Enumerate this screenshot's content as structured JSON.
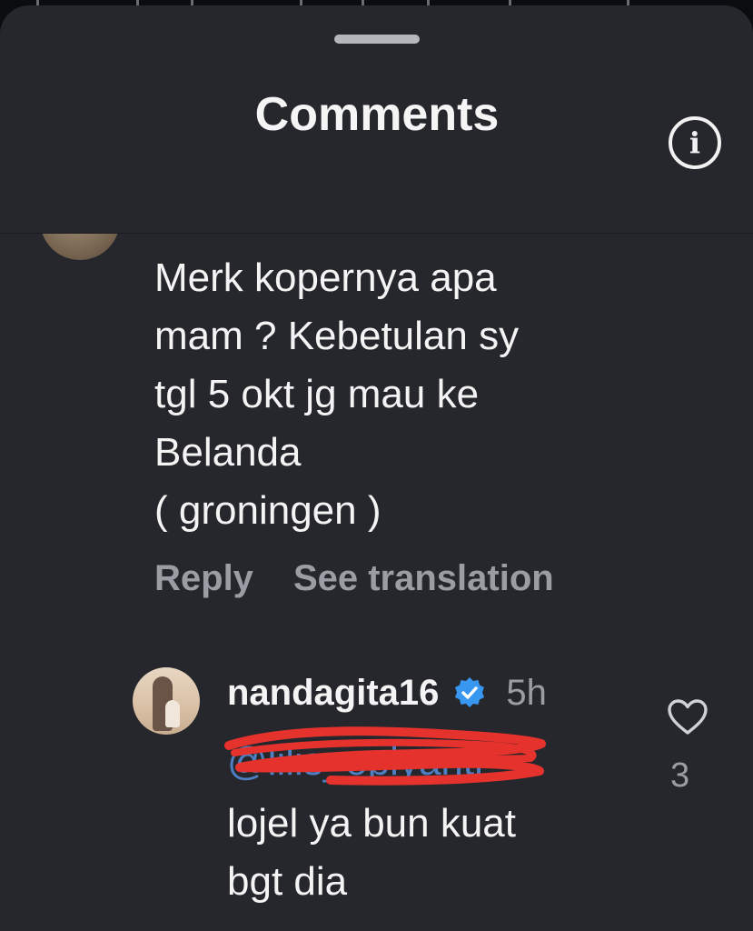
{
  "sheet": {
    "title": "Comments"
  },
  "comments": [
    {
      "lines": [
        "Merk kopernya apa",
        "mam ? Kebetulan sy",
        "tgl 5 okt jg mau ke",
        "Belanda",
        "( groningen )"
      ],
      "actions": {
        "reply": "Reply",
        "translate": "See translation"
      }
    },
    {
      "username": "nandagita16",
      "verified": true,
      "time": "5h",
      "mention": "@lilis_oplyanti",
      "lines": [
        "lojel ya bun kuat",
        "bgt dia"
      ],
      "like_count": "3"
    }
  ],
  "icons": {
    "info": "info-icon",
    "heart": "heart-icon",
    "verified": "verified-badge-icon",
    "chevron": "chevron-down-icon"
  },
  "colors": {
    "sheet_background": "#25272c",
    "primary_text": "#f4f4f5",
    "secondary_text": "#9a9da3",
    "mention": "#4f7fc3",
    "verified_badge": "#3897f0",
    "redaction_scribble": "#e5322d"
  }
}
